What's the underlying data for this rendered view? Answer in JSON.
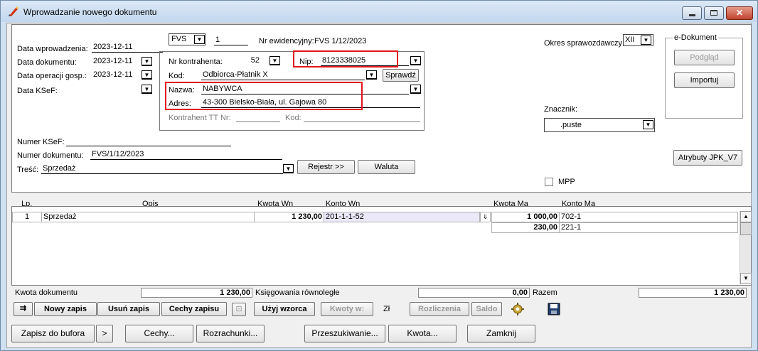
{
  "window": {
    "title": "Wprowadzanie nowego dokumentu"
  },
  "header": {
    "data_wprowadzenia_label": "Data wprowadzenia:",
    "data_wprowadzenia": "2023-12-11",
    "data_dokumentu_label": "Data dokumentu:",
    "data_dokumentu": "2023-12-11",
    "data_operacji_label": "Data operacji gosp.:",
    "data_operacji": "2023-12-11",
    "data_ksef_label": "Data KSeF:",
    "data_ksef": "",
    "doc_type": "FVS",
    "doc_number": "1",
    "nr_ewidencyjny_label": "Nr ewidencyjny:",
    "nr_ewidencyjny": "FVS   1/12/2023",
    "okres_label": "Okres sprawozdawczy:",
    "okres": "XII",
    "edoc_group": "e-Dokument",
    "podglad": "Podgląd",
    "importuj": "Importuj",
    "znacznik_label": "Znacznik:",
    "znacznik": ".puste",
    "atrybuty": "Atrybuty JPK_V7",
    "mpp": "MPP",
    "numer_ksef_label": "Numer KSeF:",
    "numer_ksef": "",
    "numer_dok_label": "Numer dokumentu:",
    "numer_dok": "FVS/1/12/2023",
    "tresc_label": "Treść:",
    "tresc": "Sprzedaż",
    "rejestr": "Rejestr >>",
    "waluta": "Waluta"
  },
  "kontrahent": {
    "nr_label": "Nr kontrahenta:",
    "nr": "52",
    "nip_label": "Nip:",
    "nip": "8123338025",
    "kod_label": "Kod:",
    "kod": "Odbiorca-Płatnik X",
    "sprawdz": "Sprawdź",
    "nazwa_label": "Nazwa:",
    "nazwa": "NABYWCA",
    "adres_label": "Adres:",
    "adres": "43-300 Bielsko-Biała, ul. Gajowa 80",
    "tt_label": "Kontrahent TT Nr:",
    "tt_kod_label": "Kod:"
  },
  "grid": {
    "headers": {
      "lp": "Lp.",
      "opis": "Opis",
      "kwota_wn": "Kwota  Wn",
      "konto_wn": "Konto  Wn",
      "kwota_ma": "Kwota Ma",
      "konto_ma": "Konto Ma"
    },
    "row": {
      "lp": "1",
      "opis": "Sprzedaż",
      "kwota_wn": "1 230,00",
      "konto_wn": "201-1-1-52"
    },
    "ma_rows": [
      {
        "kwota": "1 000,00",
        "konto": "702-1"
      },
      {
        "kwota": "230,00",
        "konto": "221-1"
      }
    ]
  },
  "totals": {
    "kwota_dok_label": "Kwota dokumentu",
    "kwota_dok": "1 230,00",
    "ksieg_label": "Księgowania równoległe",
    "ksieg": "0,00",
    "razem_label": "Razem",
    "razem": "1 230,00"
  },
  "toolbar": {
    "nowy": "Nowy zapis",
    "usun": "Usuń zapis",
    "cechy_zapisu": "Cechy zapisu",
    "uzyj_wzorca": "Użyj wzorca",
    "kwoty_w": "Kwoty w:",
    "currency": "Zł",
    "rozliczenia": "Rozliczenia",
    "saldo": "Saldo"
  },
  "bottom": {
    "zapisz": "Zapisz do bufora",
    "more": ">",
    "cechy": "Cechy...",
    "rozrachunki": "Rozrachunki...",
    "przeszukiwanie": "Przeszukiwanie...",
    "kwota": "Kwota...",
    "zamknij": "Zamknij"
  }
}
